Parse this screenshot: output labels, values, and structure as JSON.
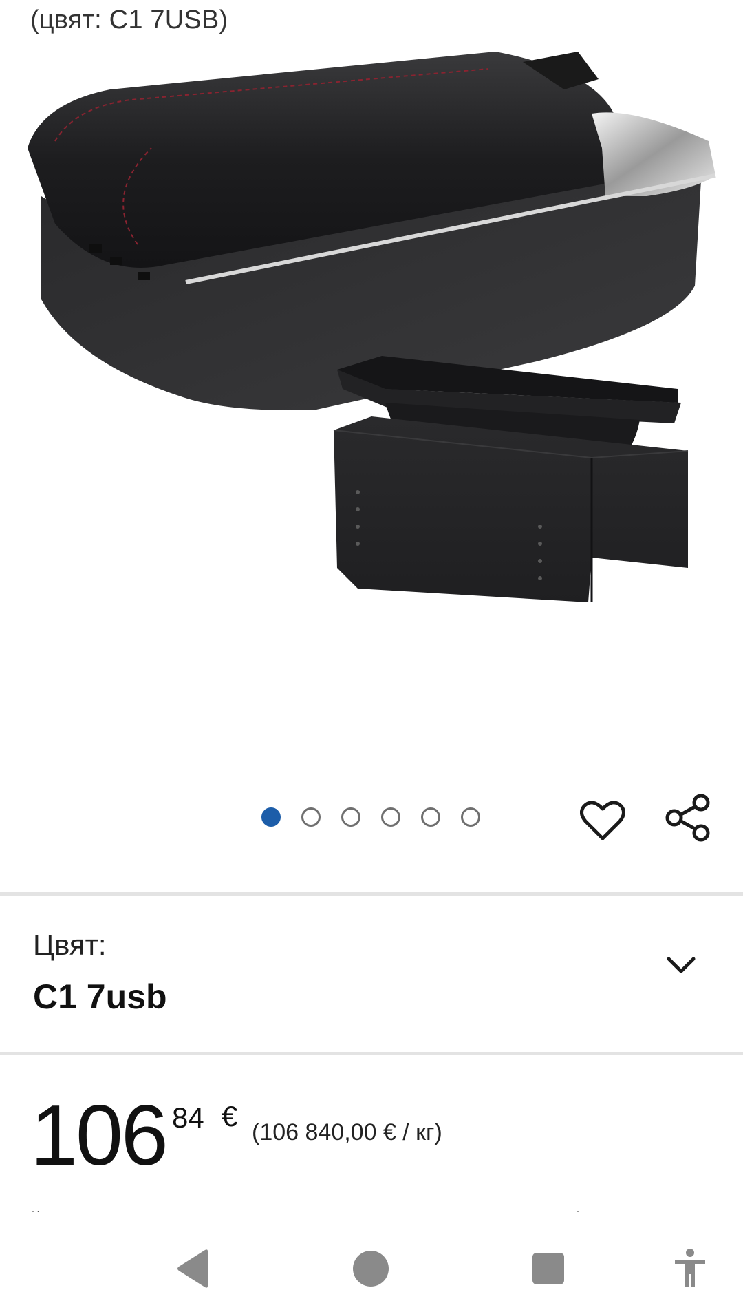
{
  "header": {
    "caption": "(цвят: C1 7USB)"
  },
  "gallery": {
    "image_count": 6,
    "active_index": 0,
    "accent_color": "#1c5da9"
  },
  "actions": {
    "favorite_icon": "heart-icon",
    "share_icon": "share-icon"
  },
  "variant": {
    "label": "Цвят:",
    "value": "C1 7usb",
    "icon": "chevron-down-icon"
  },
  "price": {
    "whole": "106",
    "fraction": "84",
    "currency": "€",
    "unit_price": "(106 840,00 € / кг)"
  },
  "navbar": {
    "back_icon": "back-triangle-icon",
    "home_icon": "home-circle-icon",
    "recents_icon": "recents-square-icon",
    "accessibility_icon": "accessibility-icon"
  }
}
